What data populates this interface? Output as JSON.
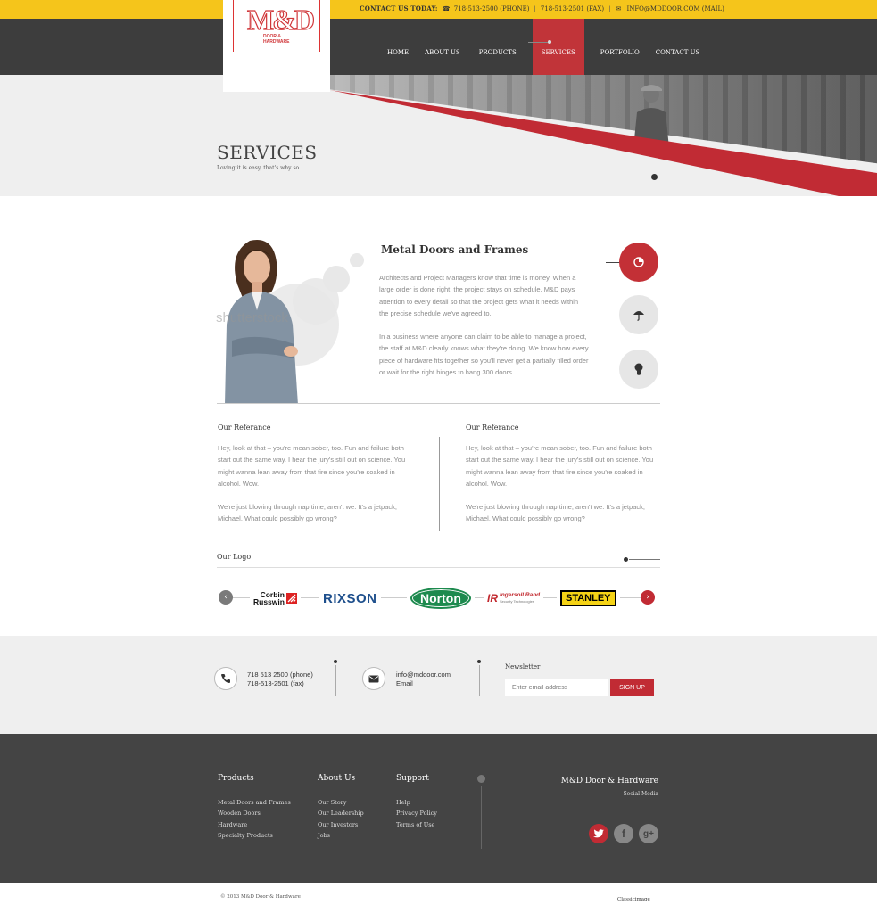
{
  "topbar": {
    "label": "CONTACT US TODAY:",
    "phone": "718-513-2500 (PHONE)",
    "fax": "718-513-2501 (FAX)",
    "email": "INFO@MDDOOR.COM (MAIL)"
  },
  "logo": {
    "mark": "M&D",
    "line1": "DOOR &",
    "line2": "HARDWARE"
  },
  "nav": {
    "items": [
      {
        "label": "HOME"
      },
      {
        "label": "ABOUT US"
      },
      {
        "label": "PRODUCTS"
      },
      {
        "label": "SERVICES"
      },
      {
        "label": "PORTFOLIO"
      },
      {
        "label": "CONTACT US"
      }
    ],
    "active": "SERVICES"
  },
  "hero": {
    "title": "SERVICES",
    "subtitle": "Loving it is easy, that's why so"
  },
  "service": {
    "watermark": "shutterstock",
    "title": "Metal Doors and Frames",
    "paragraphs": [
      "Architects and Project Managers know that time is money. When a large order is done right, the project stays on schedule. M&D pays attention to every detail so that the project gets what it needs within the precise schedule we've agreed to.",
      "In a business where anyone can claim to be able to manage a project, the staff at M&D clearly knows what they're doing. We know how every piece of hardware fits together so you'll never get a partially filled order or wait for the right hinges to hang 300 doors."
    ],
    "buttons": [
      {
        "icon": "pie-chart-icon",
        "active": true
      },
      {
        "icon": "umbrella-icon",
        "active": false
      },
      {
        "icon": "lightbulb-icon",
        "active": false
      }
    ]
  },
  "references": [
    {
      "title": "Our  Referance",
      "paragraphs": [
        "Hey, look at that – you're mean sober, too. Fun and failure both start out the same way. I hear the jury's still out on science. You might wanna lean away from that fire since you're soaked in alcohol. Wow.",
        "We're just blowing through nap time, aren't we. It's a jetpack, Michael. What could possibly go wrong?"
      ]
    },
    {
      "title": "Our  Referance",
      "paragraphs": [
        "Hey, look at that – you're mean sober, too. Fun and failure both start out the same way. I hear the jury's still out on science. You might wanna lean away from that fire since you're soaked in alcohol. Wow.",
        "We're just blowing through nap time, aren't we. It's a jetpack, Michael. What could possibly go wrong?"
      ]
    }
  ],
  "logos": {
    "title": "Our Logo",
    "corbin_1": "Corbin",
    "corbin_2": "Russwin",
    "rixson": "RIXSON",
    "norton": "Norton",
    "ir_mark": "IR",
    "ir_name": "Ingersoll Rand",
    "ir_sub": "Security Technologies",
    "stanley": "STANLEY"
  },
  "contact": {
    "phone_line1": "718 513 2500 (phone)",
    "phone_line2": "718-513-2501 (fax)",
    "email_line1": "info@mddoor.com",
    "email_line2": "Email",
    "newsletter_title": "Newsletter",
    "newsletter_placeholder": "Enter email address",
    "newsletter_button": "SIGN UP"
  },
  "footer": {
    "columns": [
      {
        "title": "Products",
        "links": [
          "Metal Doors and Frames",
          "Wooden Doors",
          "Hardware",
          "Specialty Products"
        ]
      },
      {
        "title": "About Us",
        "links": [
          "Our Story",
          "Our Leadership",
          "Our Investors",
          "Jobs"
        ]
      },
      {
        "title": "Support",
        "links": [
          "Help",
          "Privacy Policy",
          "Terms of Use"
        ]
      }
    ],
    "brand": "M&D Door & Hardware",
    "social_label": "Social Media",
    "social": [
      {
        "icon": "twitter-icon",
        "glyph": "t"
      },
      {
        "icon": "facebook-icon",
        "glyph": "f"
      },
      {
        "icon": "google-plus-icon",
        "glyph": "g+"
      }
    ],
    "copyright": "© 2013 M&D Door & Hardware",
    "credit": "Classicimage"
  },
  "colors": {
    "accent_red": "#c12b34",
    "topbar_yellow": "#f5c51b",
    "header_dark": "#3d3d3d",
    "footer_dark": "#444444"
  }
}
